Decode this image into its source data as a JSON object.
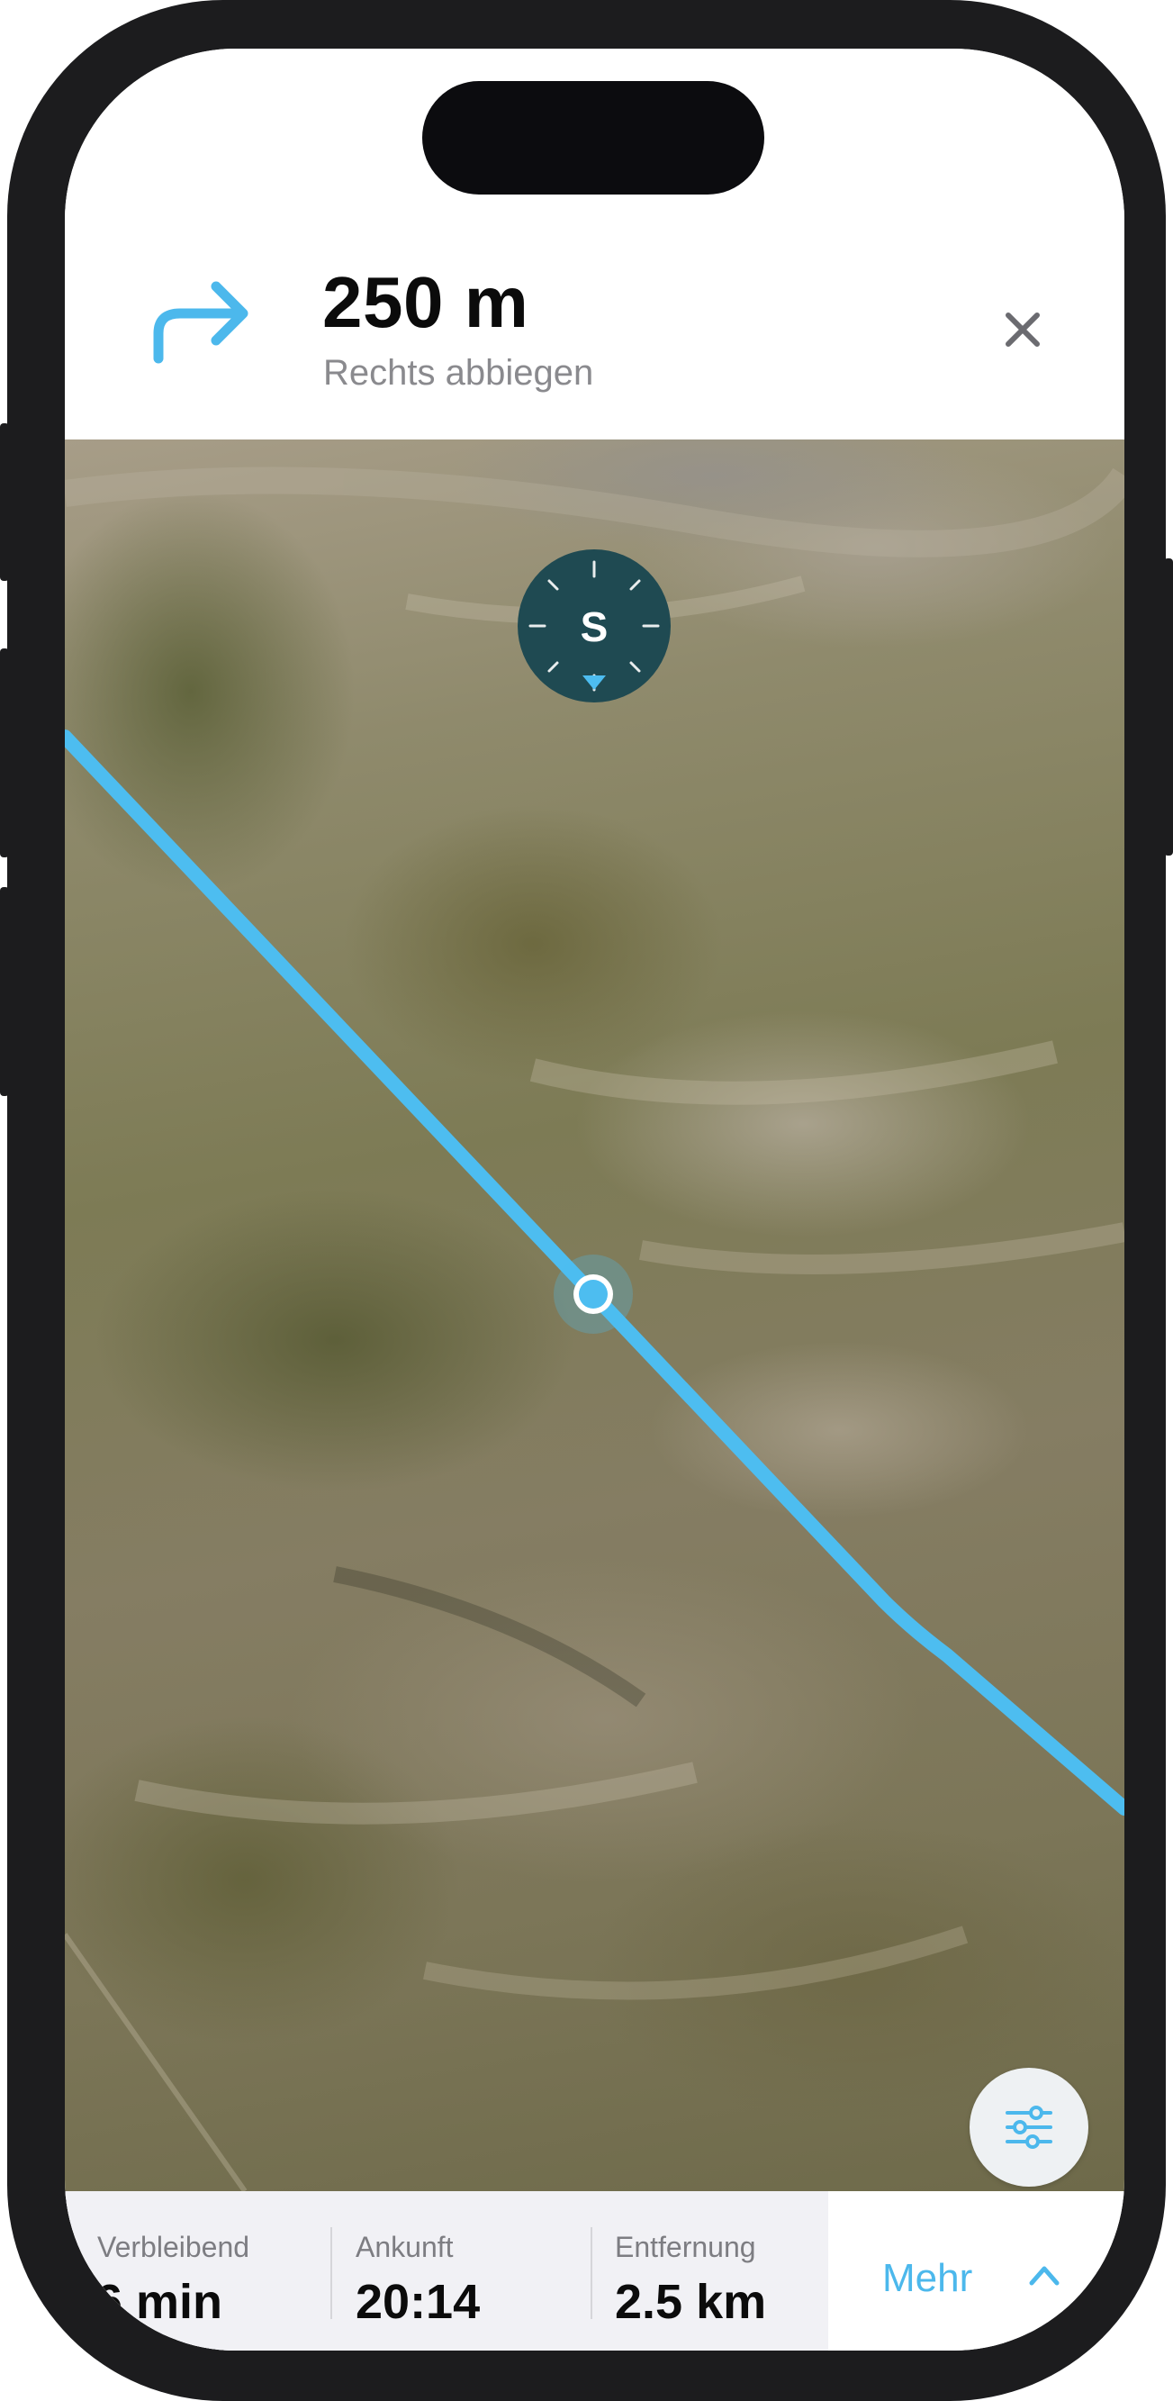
{
  "navigation": {
    "distance": "250 m",
    "instruction": "Rechts abbiegen",
    "turn_icon": "turn-right-arrow-icon",
    "close_icon": "close-icon"
  },
  "map": {
    "compass_label": "S",
    "route_color": "#4dbdf0",
    "position_marker_color": "#4dbdf0",
    "compass_color": "#1f4a52",
    "filter_icon": "sliders-icon"
  },
  "stats": [
    {
      "label": "Verbleibend",
      "value": "6 min"
    },
    {
      "label": "Ankunft",
      "value": "20:14"
    },
    {
      "label": "Entfernung",
      "value": "2.5 km"
    }
  ],
  "more": {
    "label": "Mehr",
    "icon": "chevron-up-icon"
  },
  "colors": {
    "accent": "#4cb8ec",
    "stats_background": "#f1f1f5"
  }
}
